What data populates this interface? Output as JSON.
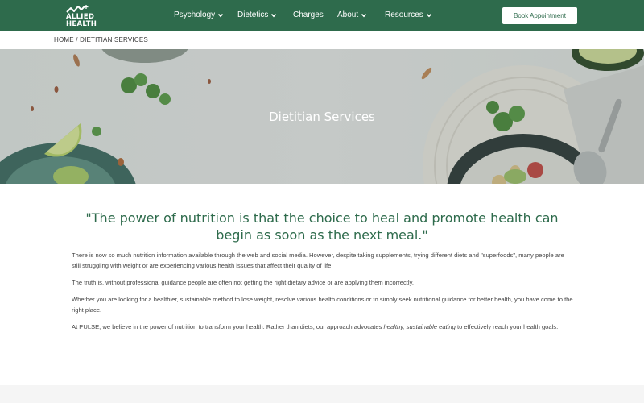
{
  "brand": {
    "line1": "ALLIED",
    "line2": "HEALTH"
  },
  "nav": [
    {
      "label": "Psychology",
      "has_dropdown": true
    },
    {
      "label": "Dietetics",
      "has_dropdown": true
    },
    {
      "label": "Charges",
      "has_dropdown": false
    },
    {
      "label": "About",
      "has_dropdown": true
    },
    {
      "label": "Resources",
      "has_dropdown": true
    }
  ],
  "cta": {
    "label": "Book Appointment"
  },
  "breadcrumb": {
    "home": "HOME",
    "separator": " / ",
    "current": "DIETITIAN SERVICES"
  },
  "hero": {
    "title": "Dietitian Services"
  },
  "content": {
    "quote": "\"The power of nutrition is that the choice to heal and promote health can begin as soon as the next meal.\"",
    "p1": "There is now so much nutrition information available through the web and social media. However, despite taking supplements, trying different diets and \"superfoods\", many people are still struggling with weight or are experiencing various health issues that affect their quality of life.",
    "p2": "The truth is, without professional guidance people are often not getting the right dietary advice or are applying them incorrectly.",
    "p3": "Whether you are looking for a healthier, sustainable method to lose weight, resolve various health conditions or to simply seek nutritional guidance for better health, you have come to the right place.",
    "p4_before": "At PULSE, we believe in the power of nutrition to transform your health. Rather than diets, our approach advocates ",
    "p4_em": "healthy, sustainable eating",
    "p4_after": " to effectively reach your health goals."
  },
  "colors": {
    "brand_green": "#2e6b4c",
    "text": "#444444",
    "white": "#ffffff"
  },
  "icons": [
    "allied-health-logo-icon",
    "chevron-down-icon"
  ]
}
